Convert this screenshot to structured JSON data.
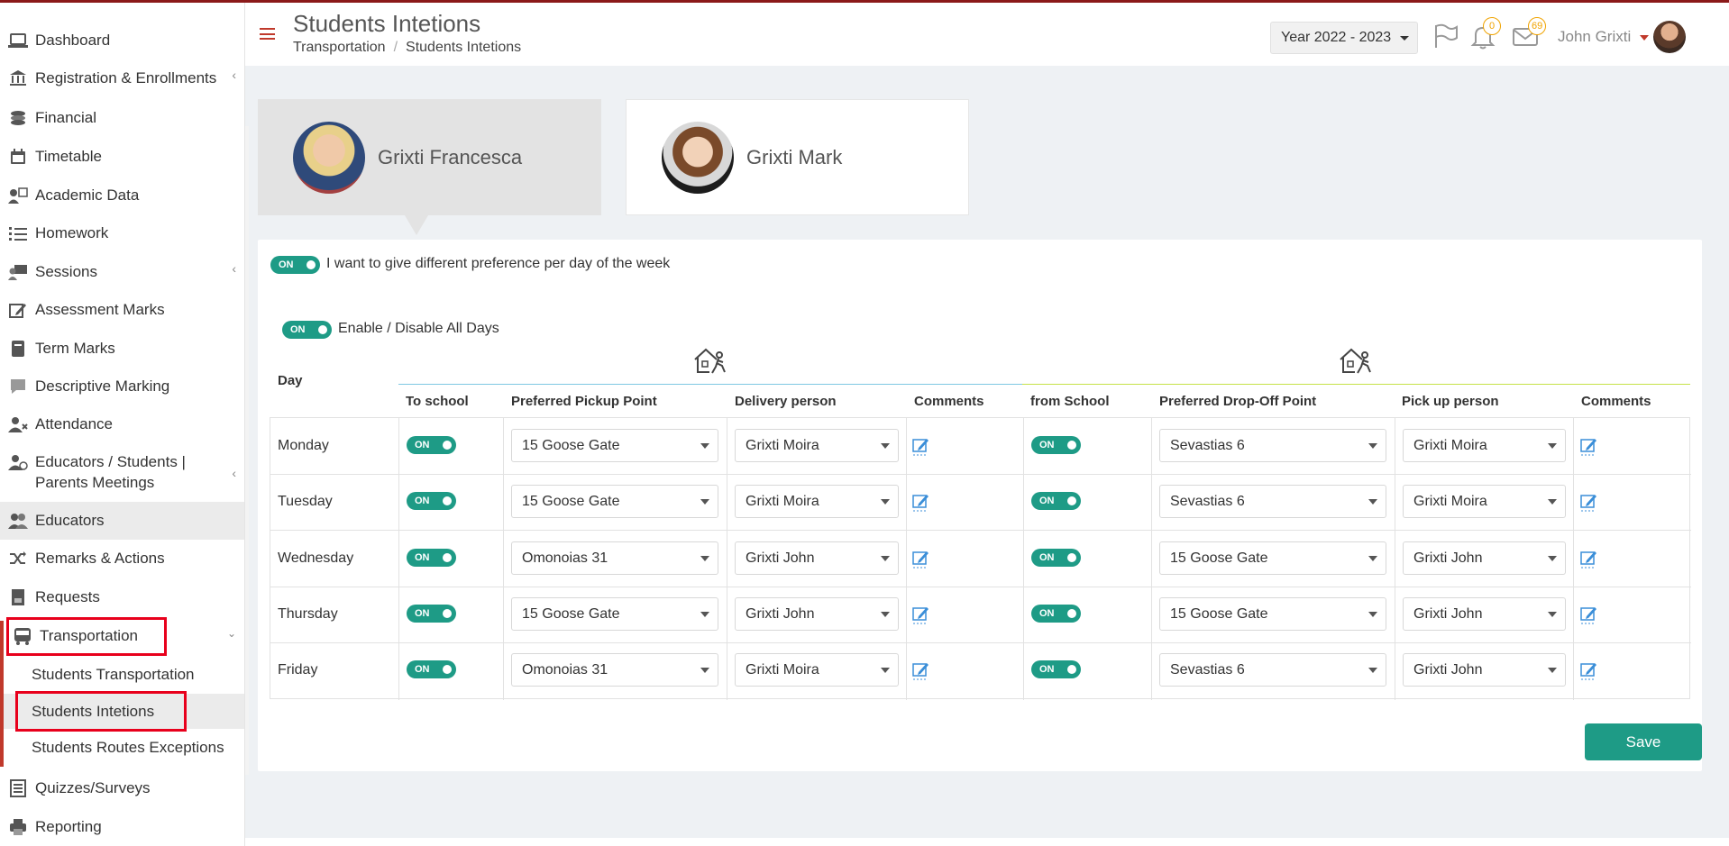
{
  "sidebar": {
    "items": [
      {
        "label": "Dashboard",
        "icon": "laptop-icon"
      },
      {
        "label": "Registration & Enrollments",
        "icon": "bank-icon"
      },
      {
        "label": "Financial",
        "icon": "coins-icon"
      },
      {
        "label": "Timetable",
        "icon": "calendar-icon"
      },
      {
        "label": "Academic Data",
        "icon": "user-chart-icon"
      },
      {
        "label": "Homework",
        "icon": "list-icon"
      },
      {
        "label": "Sessions",
        "icon": "presentation-icon"
      },
      {
        "label": "Assessment Marks",
        "icon": "pencil-icon"
      },
      {
        "label": "Term Marks",
        "icon": "notebook-icon"
      },
      {
        "label": "Descriptive Marking",
        "icon": "comment-icon"
      },
      {
        "label": "Attendance",
        "icon": "user-x-icon"
      },
      {
        "label": "Educators / Students | Parents Meetings",
        "icon": "user-clock-icon"
      },
      {
        "label": "Educators",
        "icon": "users-icon"
      },
      {
        "label": "Remarks & Actions",
        "icon": "shuffle-icon"
      },
      {
        "label": "Requests",
        "icon": "request-icon"
      },
      {
        "label": "Transportation",
        "icon": "bus-icon"
      },
      {
        "label": "Quizzes/Surveys",
        "icon": "checklist-icon"
      },
      {
        "label": "Reporting",
        "icon": "printer-icon"
      }
    ],
    "transport_sub": [
      "Students Transportation",
      "Students Intetions",
      "Students Routes Exceptions"
    ]
  },
  "header": {
    "title": "Students Intetions",
    "breadcrumb": [
      "Transportation",
      "Students Intetions"
    ],
    "year": "Year 2022 - 2023",
    "notifications_count": "0",
    "messages_count": "69",
    "user_name": "John Grixti"
  },
  "students": [
    {
      "name": "Grixti Francesca",
      "selected": true
    },
    {
      "name": "Grixti Mark",
      "selected": false
    }
  ],
  "panel": {
    "toggle_on": "ON",
    "per_day_label": "I want to give different preference per day of the week",
    "all_days_label": "Enable / Disable All Days"
  },
  "table": {
    "headers": {
      "day": "Day",
      "to_school": "To school",
      "pickup_point": "Preferred Pickup Point",
      "delivery_person": "Delivery person",
      "comments_1": "Comments",
      "from_school": "from School",
      "dropoff_point": "Preferred Drop-Off Point",
      "pickup_person": "Pick up person",
      "comments_2": "Comments"
    },
    "rows": [
      {
        "day": "Monday",
        "to": "ON",
        "pickup": "15 Goose Gate",
        "delivery": "Grixti Moira",
        "from": "ON",
        "dropoff": "Sevastias 6",
        "pickperson": "Grixti Moira"
      },
      {
        "day": "Tuesday",
        "to": "ON",
        "pickup": "15 Goose Gate",
        "delivery": "Grixti Moira",
        "from": "ON",
        "dropoff": "Sevastias 6",
        "pickperson": "Grixti Moira"
      },
      {
        "day": "Wednesday",
        "to": "ON",
        "pickup": "Omonoias 31",
        "delivery": "Grixti John",
        "from": "ON",
        "dropoff": "15 Goose Gate",
        "pickperson": "Grixti John"
      },
      {
        "day": "Thursday",
        "to": "ON",
        "pickup": "15 Goose Gate",
        "delivery": "Grixti John",
        "from": "ON",
        "dropoff": "15 Goose Gate",
        "pickperson": "Grixti John"
      },
      {
        "day": "Friday",
        "to": "ON",
        "pickup": "Omonoias 31",
        "delivery": "Grixti Moira",
        "from": "ON",
        "dropoff": "Sevastias 6",
        "pickperson": "Grixti John"
      }
    ]
  },
  "save_label": "Save",
  "colors": {
    "accent": "#1e9b86",
    "brand_red": "#c0392b",
    "highlight_box": "#e8001c"
  }
}
